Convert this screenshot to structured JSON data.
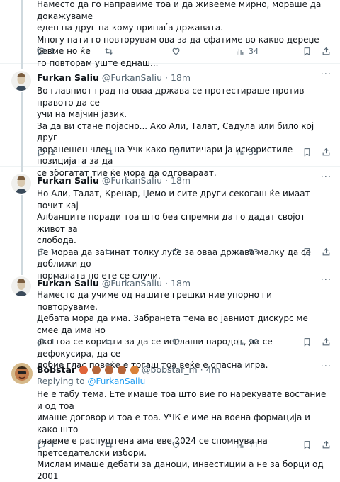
{
  "tweets": [
    {
      "name": "",
      "handle": "",
      "time": "",
      "lines": [
        "Наместо да го направиме тоа и да живееме мирно, мораше да докажуваме",
        "еден на друг на кому припаѓа државата.",
        "Многу пати го повторувам ова за да сфатиме во какво дереџе бевме но ќе",
        "го повторам уште еднаш..."
      ],
      "stats": {
        "replies": "1",
        "retweets": "",
        "likes": "",
        "views": "34"
      }
    },
    {
      "name": "Furkan Saliu",
      "handle": "@FurkanSaliu",
      "dot": "·",
      "time": "18m",
      "lines": [
        "Во главниот град на оваа држава се протестираше против правото да се",
        "учи на мајчин јазик.",
        "За да ви стане појасно... Ако Али, Талат, Садула или било кој друг",
        "поранешен член на Учк како политичари ја искористиле позицијата за да",
        "се збогатат тие ќе мора да одговараат."
      ],
      "stats": {
        "replies": "1",
        "retweets": "",
        "likes": "",
        "views": "33"
      }
    },
    {
      "name": "Furkan Saliu",
      "handle": "@FurkanSaliu",
      "dot": "·",
      "time": "18m",
      "lines": [
        "Но Али, Талат, Кренар, Џемо и сите други секогаш ќе имаат почит кај",
        "Албанците поради тоа што беа спремни да го дадат својот живот за",
        "слобода.",
        "Не мораа да загинат толку луѓе за оваа држава малку да се доближи до",
        "нормалата но ете се случи."
      ],
      "stats": {
        "replies": "1",
        "retweets": "",
        "likes": "",
        "views": "53"
      }
    },
    {
      "name": "Furkan Saliu",
      "handle": "@FurkanSaliu",
      "dot": "·",
      "time": "18m",
      "lines": [
        "Наместо да учиме од нашите грешки ние упорно ги повторуваме.",
        "Дебата мора да има. Забранета тема во јавниот дискурс ме смее да има но",
        "ако тоа се користи за да се исплаши народот, да се дефокусира, да се",
        "добие глас повеќе е тогаш тоа веќе е опасна игра."
      ],
      "stats": {
        "replies": "1",
        "retweets": "",
        "likes": "",
        "views": "90"
      }
    },
    {
      "name": "Bobstar",
      "handle": "@bobstar_m",
      "dot": "·",
      "time": "4m",
      "replying_prefix": "Replying to",
      "replying_to": "@FurkanSaliu",
      "lines": [
        "Не е табу тема. Ете имаше тоа што вие го нарекувате востание и од тоа",
        "имаше договор и тоа е тоа. УЧК е име на воена формација и како што",
        "знаеме е распуштена ама еве 2024 се спомнува на претседателски избори.",
        "Мислам имаше дебати за даноци, инвестиции а не за борци од 2001"
      ],
      "stats": {
        "replies": "1",
        "retweets": "",
        "likes": "",
        "views": "11"
      }
    }
  ],
  "icons": {
    "reply": "reply-icon",
    "retweet": "retweet-icon",
    "like": "heart-icon",
    "views": "views-chart-icon",
    "bookmark": "bookmark-icon",
    "share": "share-icon",
    "more": "more-dots-icon"
  },
  "colors": {
    "text": "#0f1419",
    "muted": "#536471",
    "link": "#1d9bf0",
    "divider": "#eff3f4",
    "thread_line": "#cfd9de"
  }
}
